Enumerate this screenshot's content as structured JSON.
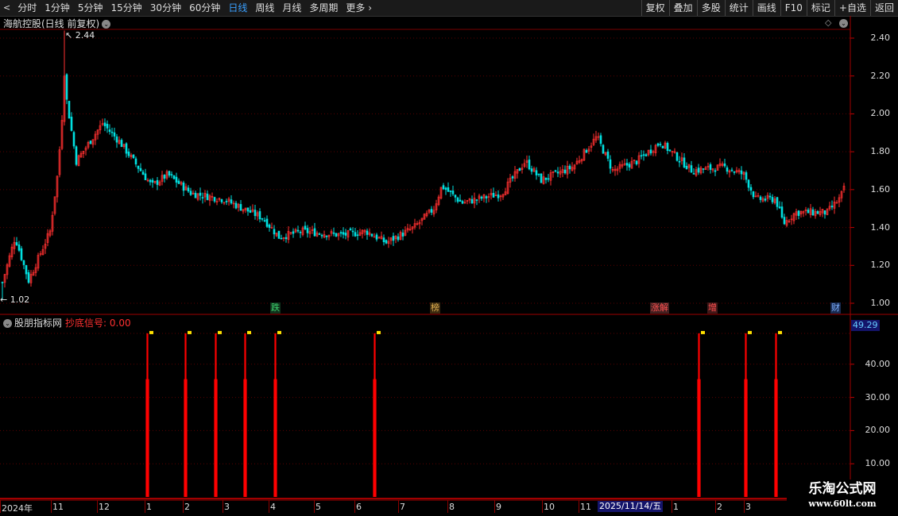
{
  "toolbar": {
    "periods": [
      "分时",
      "1分钟",
      "5分钟",
      "15分钟",
      "30分钟",
      "60分钟",
      "日线",
      "周线",
      "月线",
      "多周期",
      "更多"
    ],
    "active_period": "日线",
    "more_icon": "chevron-right-icon",
    "right_buttons": [
      "复权",
      "叠加",
      "多股",
      "统计",
      "画线",
      "F10",
      "标记",
      "+自选",
      "返回"
    ]
  },
  "main_panel": {
    "title": "海航控股(日线 前复权)",
    "high_label": "2.44",
    "low_label": "1.02",
    "price_axis": [
      "2.40",
      "2.20",
      "2.00",
      "1.80",
      "1.60",
      "1.40",
      "1.20",
      "1.00"
    ],
    "up_color": "#ff3030",
    "down_color": "#00e0e0"
  },
  "event_tags": [
    {
      "text": "跌",
      "color": "#3cd26e",
      "bg": "#10331c"
    },
    {
      "text": "榜",
      "color": "#e0b050",
      "bg": "#3a2a10"
    },
    {
      "text": "涨解",
      "color": "#ff5050",
      "bg": "#402020"
    },
    {
      "text": "增",
      "color": "#ff5050",
      "bg": "#401818"
    },
    {
      "text": "财",
      "color": "#7fb0ff",
      "bg": "#182a50"
    }
  ],
  "indicator_panel": {
    "name": "股朋指标网",
    "signal_label": "抄底信号: 0.00",
    "current_value": "49.29",
    "axis": [
      "40.00",
      "30.00",
      "20.00",
      "10.00"
    ],
    "signal_color": "#ff0000"
  },
  "date_axis": {
    "labels": [
      "2024年",
      "11",
      "12",
      "1",
      "2",
      "3",
      "4",
      "5",
      "6",
      "7",
      "8",
      "9",
      "10",
      "11",
      "1",
      "2",
      "3"
    ],
    "cursor_date": "2025/11/14/五"
  },
  "watermark": {
    "title": "乐淘公式网",
    "url": "www.60lt.com"
  },
  "chart_data": {
    "type": "candlestick",
    "price_ylim": [
      1.0,
      2.44
    ],
    "price_axis_ticks": [
      2.4,
      2.2,
      2.0,
      1.8,
      1.6,
      1.4,
      1.2,
      1.0
    ],
    "high": 2.44,
    "low": 1.02,
    "trend_points": [
      [
        0,
        1.08
      ],
      [
        18,
        1.35
      ],
      [
        35,
        1.12
      ],
      [
        62,
        1.38
      ],
      [
        72,
        1.7
      ],
      [
        80,
        2.15
      ],
      [
        95,
        1.75
      ],
      [
        128,
        1.95
      ],
      [
        150,
        1.85
      ],
      [
        190,
        1.62
      ],
      [
        210,
        1.68
      ],
      [
        240,
        1.58
      ],
      [
        280,
        1.55
      ],
      [
        330,
        1.45
      ],
      [
        350,
        1.35
      ],
      [
        380,
        1.38
      ],
      [
        430,
        1.36
      ],
      [
        460,
        1.38
      ],
      [
        485,
        1.32
      ],
      [
        520,
        1.4
      ],
      [
        545,
        1.5
      ],
      [
        555,
        1.62
      ],
      [
        580,
        1.53
      ],
      [
        630,
        1.58
      ],
      [
        660,
        1.75
      ],
      [
        680,
        1.65
      ],
      [
        720,
        1.72
      ],
      [
        750,
        1.88
      ],
      [
        770,
        1.7
      ],
      [
        800,
        1.75
      ],
      [
        830,
        1.85
      ],
      [
        870,
        1.7
      ],
      [
        910,
        1.72
      ],
      [
        935,
        1.68
      ],
      [
        950,
        1.55
      ],
      [
        975,
        1.55
      ],
      [
        985,
        1.42
      ],
      [
        1000,
        1.48
      ],
      [
        1040,
        1.48
      ],
      [
        1055,
        1.55
      ],
      [
        1063,
        1.62
      ]
    ],
    "indicator_ylim": [
      0,
      50
    ],
    "indicator_axis_ticks": [
      40,
      30,
      20,
      10
    ],
    "signal_bar_values": [
      49.3,
      49.3,
      49.3,
      49.3,
      49.3,
      49.3,
      49.3,
      49.3,
      49.3
    ]
  }
}
